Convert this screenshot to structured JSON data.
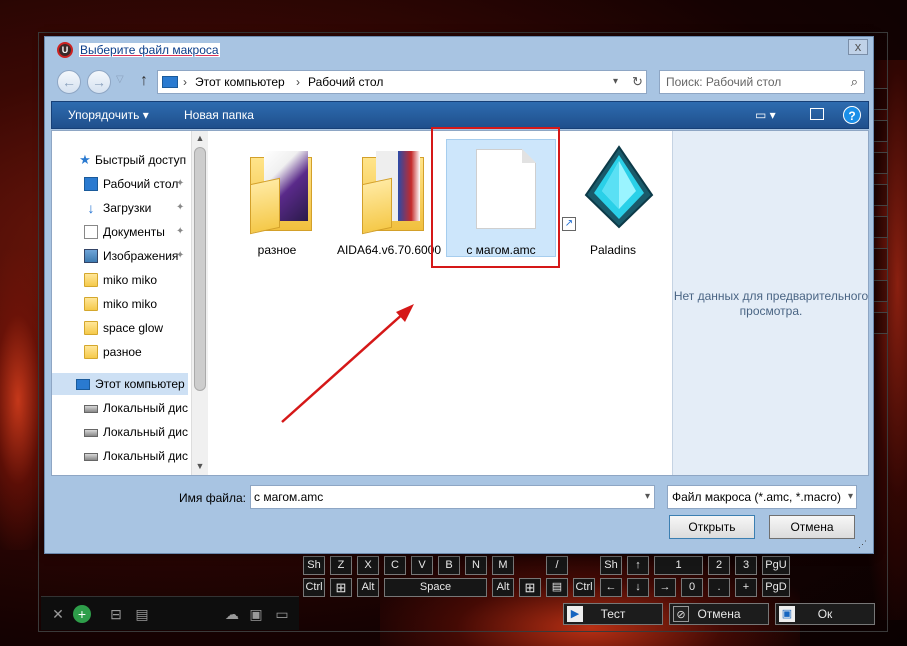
{
  "dialog": {
    "title": "Выберите файл макроса",
    "close": "x"
  },
  "nav": {
    "back": "←",
    "forward": "→",
    "up": "↑",
    "breadcrumb": [
      "Этот компьютер",
      "Рабочий стол"
    ],
    "search_placeholder": "Поиск: Рабочий стол"
  },
  "toolbar": {
    "organize": "Упорядочить ▾",
    "new_folder": "Новая папка",
    "help": "?"
  },
  "sidebar": {
    "items": [
      {
        "label": "Быстрый доступ",
        "icon": "star-icon"
      },
      {
        "label": "Рабочий стол",
        "icon": "desktop-icon",
        "pinned": true
      },
      {
        "label": "Загрузки",
        "icon": "download-icon",
        "pinned": true
      },
      {
        "label": "Документы",
        "icon": "document-icon",
        "pinned": true
      },
      {
        "label": "Изображения",
        "icon": "pictures-icon",
        "pinned": true
      },
      {
        "label": "miko miko",
        "icon": "folder-icon"
      },
      {
        "label": "miko miko",
        "icon": "folder-icon"
      },
      {
        "label": "space glow",
        "icon": "folder-icon"
      },
      {
        "label": "разное",
        "icon": "folder-icon"
      },
      {
        "label": "Этот компьютер",
        "icon": "computer-icon"
      },
      {
        "label": "Локальный диск",
        "icon": "drive-icon"
      },
      {
        "label": "Локальный диск",
        "icon": "drive-icon"
      },
      {
        "label": "Локальный диск",
        "icon": "drive-icon"
      }
    ]
  },
  "files": [
    {
      "name": "разное",
      "type": "folder"
    },
    {
      "name": "AIDA64.v6.70.6000",
      "type": "folder"
    },
    {
      "name": "с магом.amc",
      "type": "file",
      "selected": true
    },
    {
      "name": "Paladins",
      "type": "shortcut"
    }
  ],
  "preview": {
    "text": "Нет данных для предварительного просмотра."
  },
  "footer": {
    "filename_label": "Имя файла:",
    "filename_value": "с магом.amc",
    "filetype": "Файл макроса (*.amc, *.macro)",
    "open": "Открыть",
    "cancel": "Отмена"
  },
  "app": {
    "row1": [
      "Sh",
      "Z",
      "X",
      "C",
      "V",
      "B",
      "N",
      "M",
      "/",
      "Sh",
      "↑",
      "1",
      "2",
      "3",
      "PgU"
    ],
    "row2": [
      "Ctrl",
      "",
      "Alt",
      "Space",
      "Alt",
      "",
      "",
      "Ctrl",
      "←",
      "↓",
      "→",
      "0",
      ".",
      "+",
      "PgD"
    ],
    "test": "Тест",
    "cancel": "Отмена",
    "ok": "Ок"
  },
  "colors": {
    "accent": "#1f4f8c",
    "annotation": "#d51818",
    "selection": "#cde6fb"
  }
}
